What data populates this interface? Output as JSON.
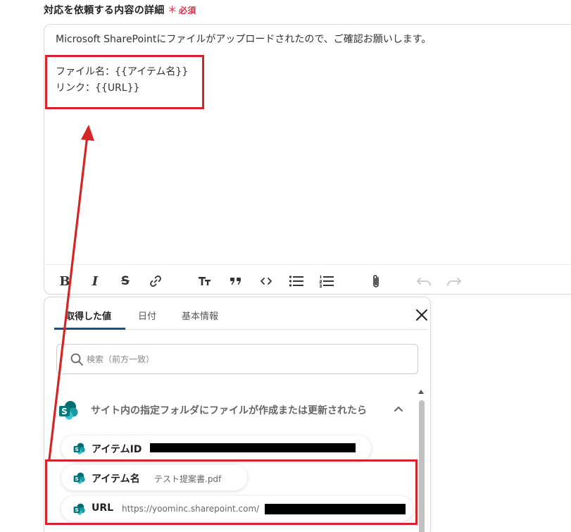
{
  "field": {
    "label": "対応を依頼する内容の詳細",
    "required_mark": "＊",
    "required_text": "必須"
  },
  "editor": {
    "lines": [
      "Microsoft SharePointにファイルがアップロードされたので、ご確認お願いします。",
      "",
      "ファイル名：{{アイテム名}}",
      "リンク：{{URL}}"
    ],
    "toolbar": {
      "bold": "B",
      "italic": "I",
      "strike": "S",
      "link": "link-icon",
      "heading": "text-size-icon",
      "quote": "quote-icon",
      "code": "code-icon",
      "bullet_list": "bullet-list-icon",
      "numbered_list": "numbered-list-icon",
      "attach": "paperclip-icon",
      "undo": "undo-icon",
      "redo": "redo-icon"
    }
  },
  "panel": {
    "tabs": [
      {
        "label": "取得した値",
        "active": true
      },
      {
        "label": "日付",
        "active": false
      },
      {
        "label": "基本情報",
        "active": false
      }
    ],
    "search": {
      "placeholder": "検索（前方一致）",
      "value": ""
    },
    "group": {
      "title": "サイト内の指定フォルダにファイルが作成または更新されたら",
      "expanded": true
    },
    "items": [
      {
        "label": "アイテムID",
        "value": "",
        "redacted": true
      },
      {
        "label": "アイテム名",
        "value": "テスト提案書.pdf",
        "redacted": false
      },
      {
        "label": "URL",
        "value": "https://yoominc.sharepoint.com/",
        "redacted": true
      }
    ]
  },
  "colors": {
    "accent": "#1f4f7a",
    "required": "#e0284a",
    "annotation": "#d42626",
    "sharepoint_teal": "#038387"
  }
}
